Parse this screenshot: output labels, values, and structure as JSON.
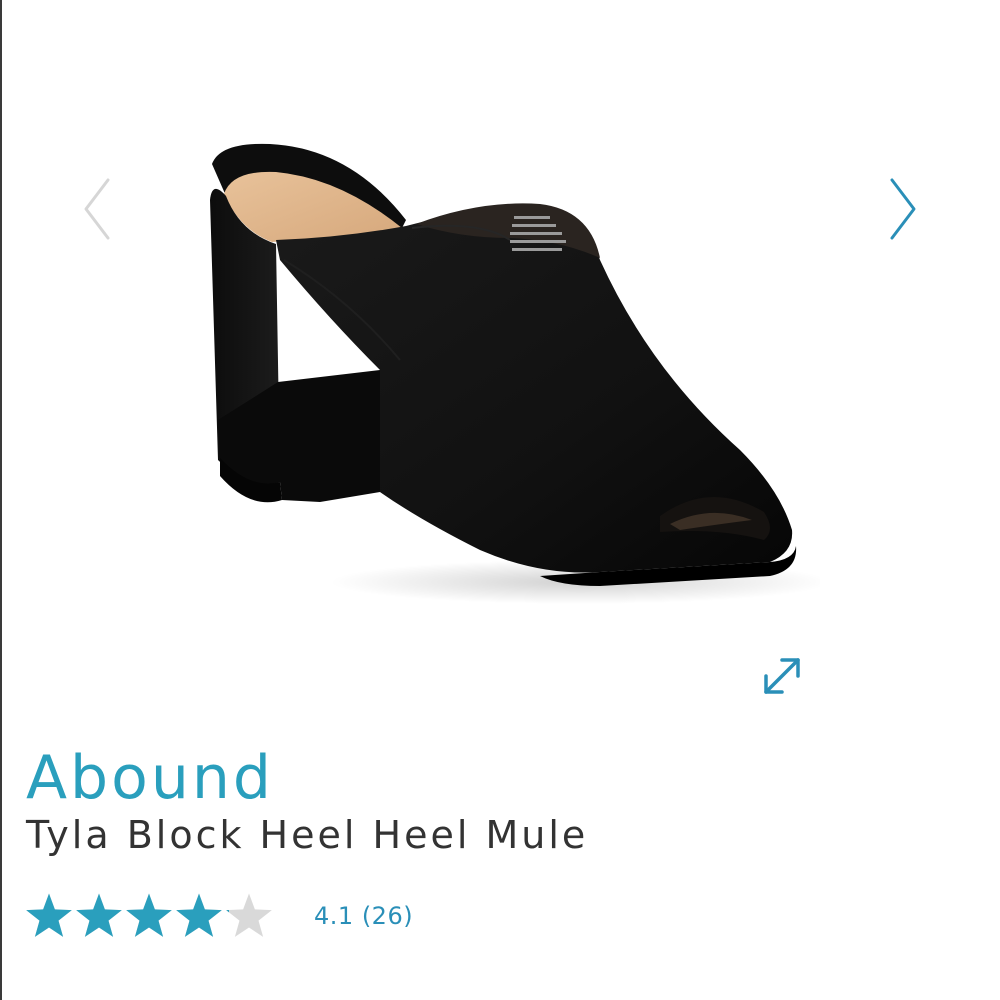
{
  "colors": {
    "accent": "#2a9fbd",
    "star_filled": "#2a9fbd",
    "star_empty": "#d9d9d9",
    "brand_text": "#2a9fbd",
    "name_text": "#333333",
    "rating_text": "#2a8fb8",
    "arrow_inactive": "#d6d6d6",
    "arrow_active": "#2a8fb8"
  },
  "gallery": {
    "image_semantic": "black suede block heel mule shoe",
    "prev_icon": "chevron-left-icon",
    "next_icon": "chevron-right-icon",
    "expand_icon": "expand-icon"
  },
  "product": {
    "brand": "Abound",
    "name": "Tyla Block Heel Heel Mule"
  },
  "rating": {
    "value": 4.1,
    "max": 5,
    "score_label": "4.1",
    "count_label": "(26)",
    "text": "4.1 (26)"
  }
}
